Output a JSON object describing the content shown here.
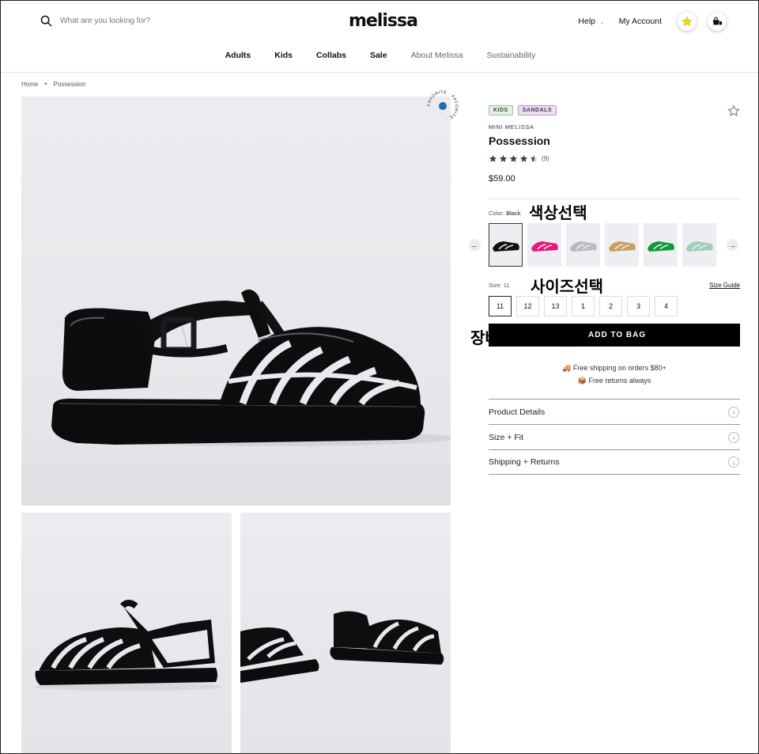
{
  "header": {
    "search_placeholder": "What are you looking for?",
    "logo": "melissa",
    "help_label": "Help",
    "help_chevron": "⌄",
    "account_label": "My Account"
  },
  "nav": {
    "items": [
      "Adults",
      "Kids",
      "Collabs",
      "Sale",
      "About Melissa",
      "Sustainability"
    ]
  },
  "breadcrumb": {
    "home": "Home",
    "separator": "•",
    "current": "Possession"
  },
  "favorite_badge": {
    "text": "FAVORITE · FAVORITE · "
  },
  "product": {
    "tags": [
      "KIDS",
      "SANDALS"
    ],
    "brand": "MINI MELISSA",
    "name": "Possession",
    "rating": {
      "value": 4.5,
      "max": 5,
      "count": "(9)"
    },
    "price": "$59.00",
    "color_label": "Color:",
    "color_value": "Black",
    "swatch_colors": [
      "#111111",
      "#e8187a",
      "#c9cbd0",
      "#c9a060",
      "#119a3c",
      "#9fcfb5"
    ],
    "arrow_left": "←",
    "arrow_right": "→",
    "size_label": "Size:",
    "size_value": "11",
    "size_guide": "Size Guide",
    "sizes": [
      "11",
      "12",
      "13",
      "1",
      "2",
      "3",
      "4"
    ],
    "add_to_bag": "ADD TO BAG",
    "shipping_line": "🚚 Free shipping on orders $80+",
    "returns_line": "📦 Free returns always",
    "accordion": [
      "Product Details",
      "Size + Fit",
      "Shipping + Returns"
    ],
    "accordion_icon": "↓"
  },
  "annotations": {
    "color_select": "색상선택",
    "size_select": "사이즈선택",
    "add_to_cart": "장바구니 담기"
  },
  "colors": {
    "tag_kids_bg": "#e6f1e6",
    "tag_sandals_bg": "#ebdff0",
    "star_color": "#4b3a52",
    "badge_dot": "#1e6fa5",
    "bag_button": "#000000"
  }
}
